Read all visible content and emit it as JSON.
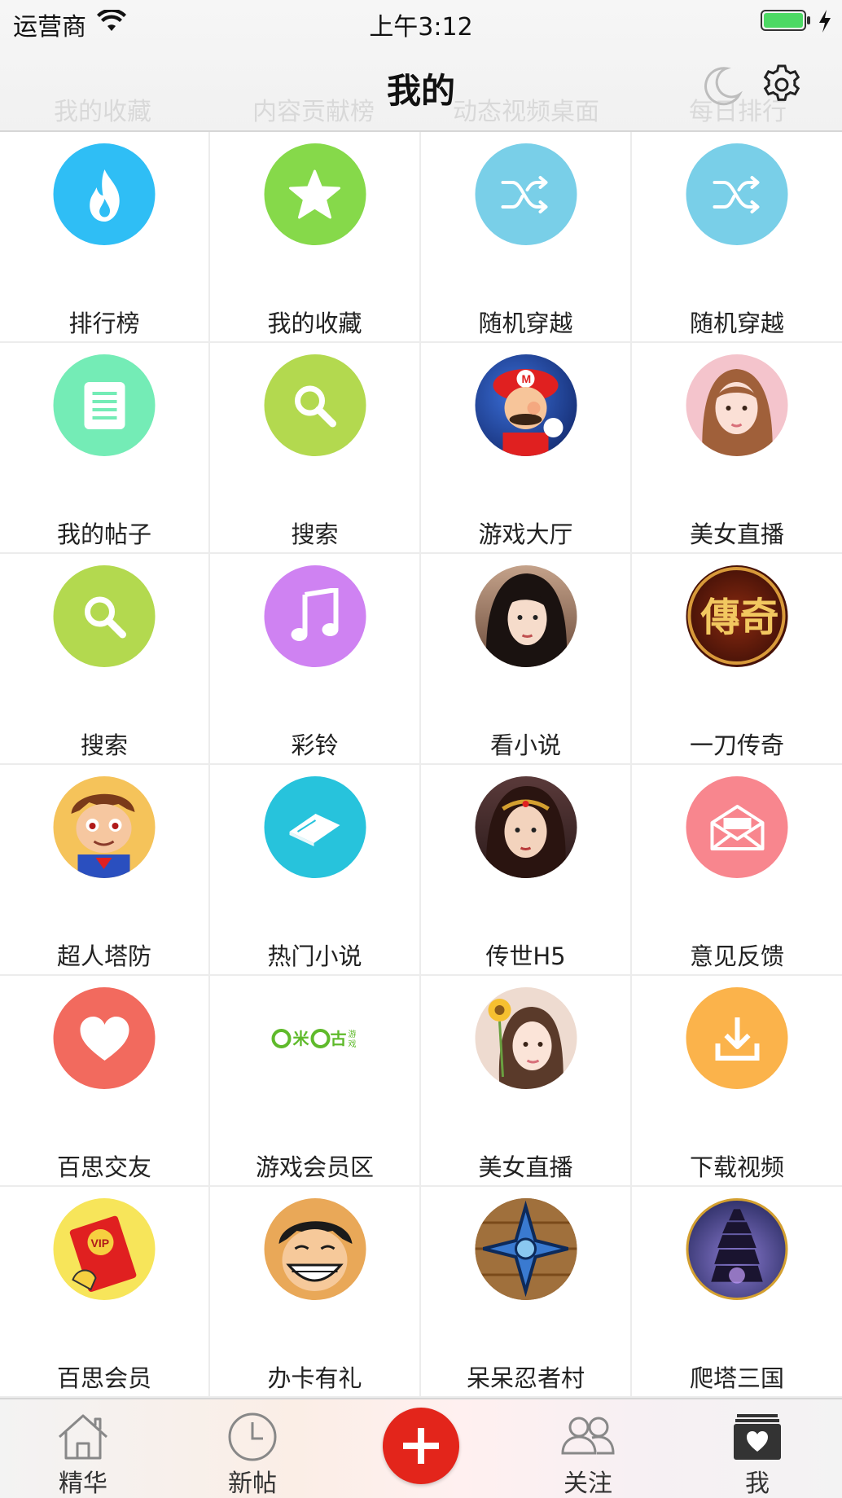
{
  "status_bar": {
    "carrier": "运营商",
    "time": "上午3:12"
  },
  "header": {
    "title": "我的",
    "ghost_tabs": [
      "我的收藏",
      "内容贡献榜",
      "动态视频桌面",
      "每日排行"
    ]
  },
  "grid": {
    "items": [
      {
        "label": "排行榜",
        "icon": "flame-icon",
        "color": "#2fbef5"
      },
      {
        "label": "我的收藏",
        "icon": "star-icon",
        "color": "#86d94a"
      },
      {
        "label": "随机穿越",
        "icon": "shuffle-icon",
        "color": "#79cfe8"
      },
      {
        "label": "随机穿越",
        "icon": "shuffle-icon",
        "color": "#79cfe8"
      },
      {
        "label": "我的帖子",
        "icon": "document-icon",
        "color": "#74ecb6"
      },
      {
        "label": "搜索",
        "icon": "search-icon",
        "color": "#b3d94f"
      },
      {
        "label": "游戏大厅",
        "icon": "mario-avatar-icon",
        "color": "#1b3a8a"
      },
      {
        "label": "美女直播",
        "icon": "girl-avatar-icon",
        "color": "#f2b9c0"
      },
      {
        "label": "搜索",
        "icon": "search-icon",
        "color": "#b3d94f"
      },
      {
        "label": "彩铃",
        "icon": "music-note-icon",
        "color": "#cf82f2"
      },
      {
        "label": "看小说",
        "icon": "lady-portrait-icon",
        "color": "#7a5a4a"
      },
      {
        "label": "一刀传奇",
        "icon": "legend-logo-icon",
        "color": "#5a1208"
      },
      {
        "label": "超人塔防",
        "icon": "superman-kid-icon",
        "color": "#f5c35a"
      },
      {
        "label": "热门小说",
        "icon": "book-icon",
        "color": "#27c3dc"
      },
      {
        "label": "传世H5",
        "icon": "warrior-girl-icon",
        "color": "#4a3030"
      },
      {
        "label": "意见反馈",
        "icon": "mail-icon",
        "color": "#f8868e"
      },
      {
        "label": "百思交友",
        "icon": "heart-icon",
        "color": "#f26a5e"
      },
      {
        "label": "游戏会员区",
        "icon": "migu-logo-icon",
        "color": "#5fba2b"
      },
      {
        "label": "美女直播",
        "icon": "girl-flower-icon",
        "color": "#e9d0c4"
      },
      {
        "label": "下载视频",
        "icon": "download-icon",
        "color": "#fbb34b"
      },
      {
        "label": "百思会员",
        "icon": "vip-envelope-icon",
        "color": "#f7e55a"
      },
      {
        "label": "办卡有礼",
        "icon": "luffy-avatar-icon",
        "color": "#e0a25a"
      },
      {
        "label": "呆呆忍者村",
        "icon": "shuriken-icon",
        "color": "#8a5a2a"
      },
      {
        "label": "爬塔三国",
        "icon": "tower-icon",
        "color": "#2a3570"
      }
    ]
  },
  "tabbar": {
    "tabs": [
      {
        "label": "精华",
        "icon": "home-icon"
      },
      {
        "label": "新帖",
        "icon": "clock-icon"
      },
      {
        "label": "关注",
        "icon": "people-icon"
      },
      {
        "label": "我",
        "icon": "heart-box-icon"
      }
    ],
    "publish_icon": "plus-icon",
    "publish_color": "#e3251b"
  },
  "colors": {
    "divider": "#ececec",
    "nav_bg": "#f4f4f4",
    "battery_green": "#4cd964"
  }
}
